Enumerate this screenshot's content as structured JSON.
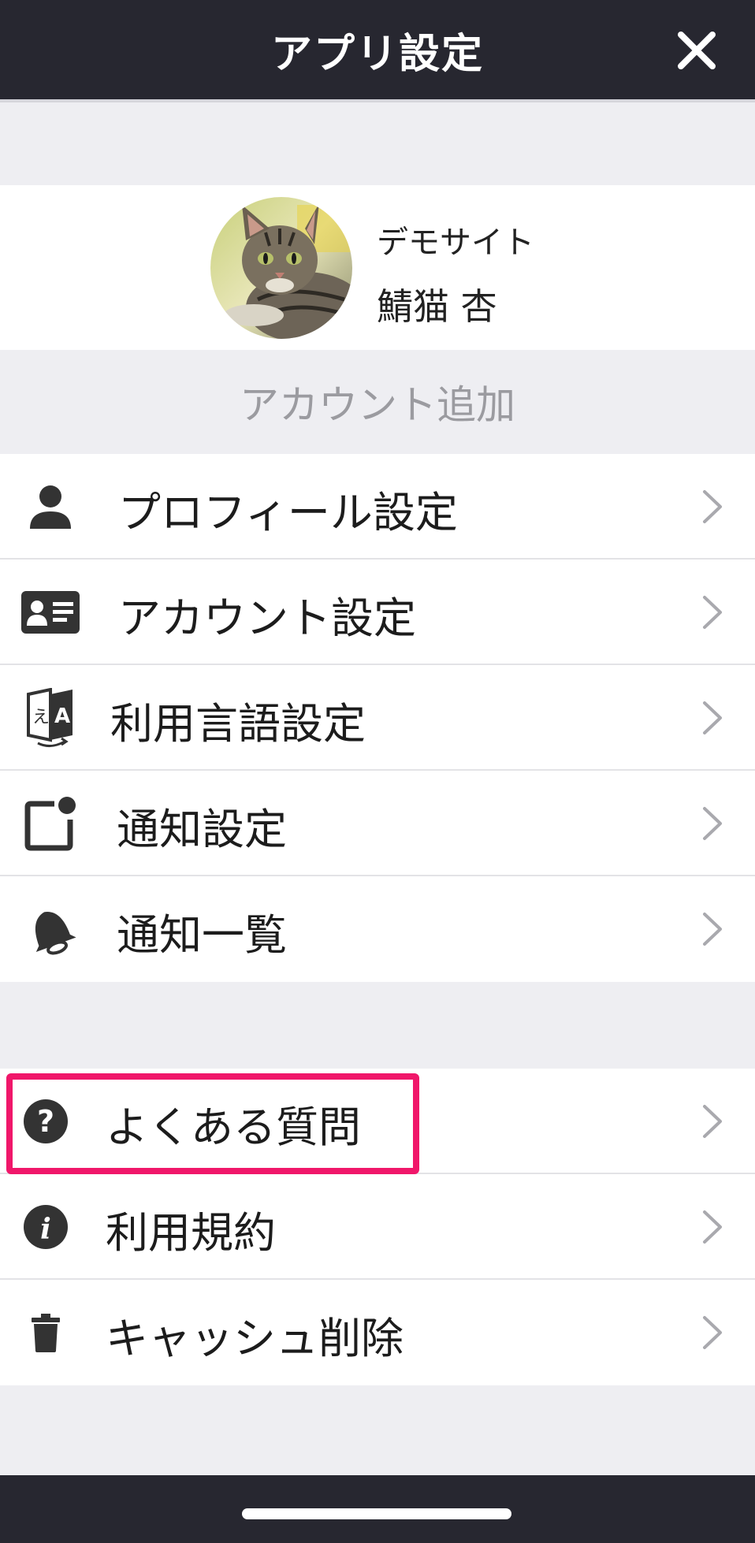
{
  "header": {
    "title": "アプリ設定",
    "close_icon": "close-icon"
  },
  "profile": {
    "site_name": "デモサイト",
    "user_name": "鯖猫 杏",
    "avatar_icon": "cat-photo-avatar"
  },
  "add_account": {
    "label": "アカウント追加"
  },
  "menu_group_1": [
    {
      "label": "プロフィール設定",
      "icon": "person-icon"
    },
    {
      "label": "アカウント設定",
      "icon": "id-card-icon"
    },
    {
      "label": "利用言語設定",
      "icon": "translate-icon"
    },
    {
      "label": "通知設定",
      "icon": "notification-badge-icon"
    },
    {
      "label": "通知一覧",
      "icon": "bell-icon"
    }
  ],
  "menu_group_2": [
    {
      "label": "よくある質問",
      "icon": "question-circle-icon"
    },
    {
      "label": "利用規約",
      "icon": "info-circle-icon"
    },
    {
      "label": "キャッシュ削除",
      "icon": "trash-icon"
    }
  ],
  "colors": {
    "header_bg": "#272730",
    "page_bg": "#eeeef2",
    "highlight": "#f0176a",
    "chevron": "#a9a9ae",
    "muted_text": "#9b9ba0"
  }
}
